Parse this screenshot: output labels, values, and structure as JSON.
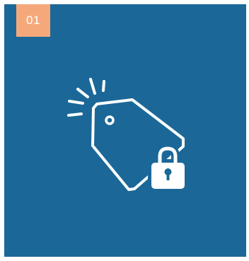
{
  "badge": {
    "number": "01"
  },
  "colors": {
    "card_background": "#1b6898",
    "badge_background": "#f5a97b",
    "icon": "#ffffff"
  },
  "icons": {
    "illustration": "price-tag-with-padlock-icon"
  }
}
